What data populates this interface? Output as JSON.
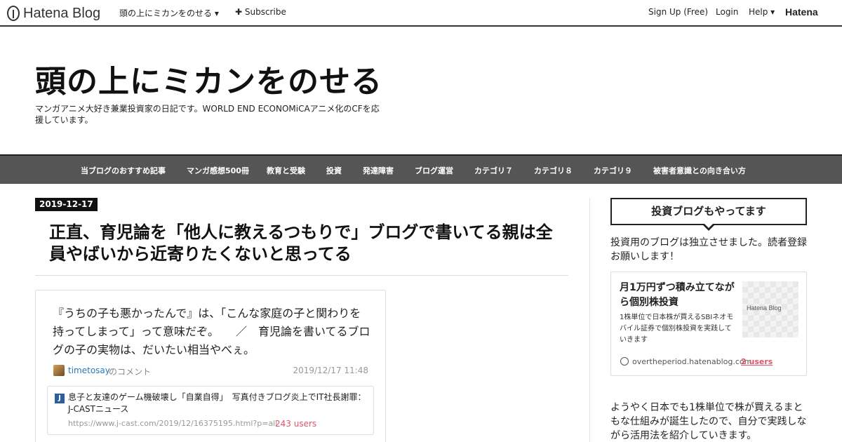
{
  "topbar": {
    "logo": "Hatena Blog",
    "blog_menu": "頭の上にミカンをのせる ▾",
    "subscribe": "✚ Subscribe",
    "signup": "Sign Up (Free)",
    "login": "Login",
    "help": "Help ▾",
    "hatena": "Hatena"
  },
  "header": {
    "title": "頭の上にミカンをのせる",
    "description": "マンガアニメ大好き兼業投資家の日記です。WORLD END ECONOMiCAアニメ化のCFを応援しています。"
  },
  "nav": {
    "items": [
      "当ブログのおすすめ記事",
      "マンガ感想500冊",
      "教育と受験",
      "投資",
      "発達障害",
      "ブログ運営",
      "カテゴリ７",
      "カテゴリ８",
      "カテゴリ９",
      "被害者意識との向き合い方"
    ]
  },
  "entry": {
    "date": "2019-12-17",
    "title": "正直、育児論を「他人に教えるつもりで」ブログで書いてる親は全員やばいから近寄りたくないと思ってる",
    "comment": {
      "text": "『うちの子も悪かったんで』は、「こんな家庭の子と関わりを持ってしまって」って意味だぞ。　　／　育児論を書いてるブログの子の実物は、だいたい相当やべぇ。",
      "user": "timetosay",
      "suffix": "のコメント",
      "time": "2019/12/17 11:48",
      "link": {
        "favicon": "J",
        "title": "息子と友達のゲーム機破壊し「自業自得」　写真付きブログ炎上でIT社長謝罪：J-CASTニュース",
        "url": "https://www.j-cast.com/2019/12/16375195.html?p=all",
        "users": "243 users"
      }
    }
  },
  "sidebar": {
    "heading": "投資ブログもやってます",
    "intro": "投資用のブログは独立させました。読者登録お願いします！",
    "embed": {
      "title": "月1万円ずつ積み立てながら個別株投資",
      "thumb_label": "Hatena Blog",
      "description": "1株単位で日本株が買えるSBIネオモバイル証券で個別株投資を実践していきます",
      "domain": "overtheperiod.hatenablog.com",
      "users": "2 users"
    },
    "body": "ようやく日本でも1株単位で株が買えるまともな仕組みが誕生したので、自分で実践しながら活用法を紹介していきます。"
  }
}
